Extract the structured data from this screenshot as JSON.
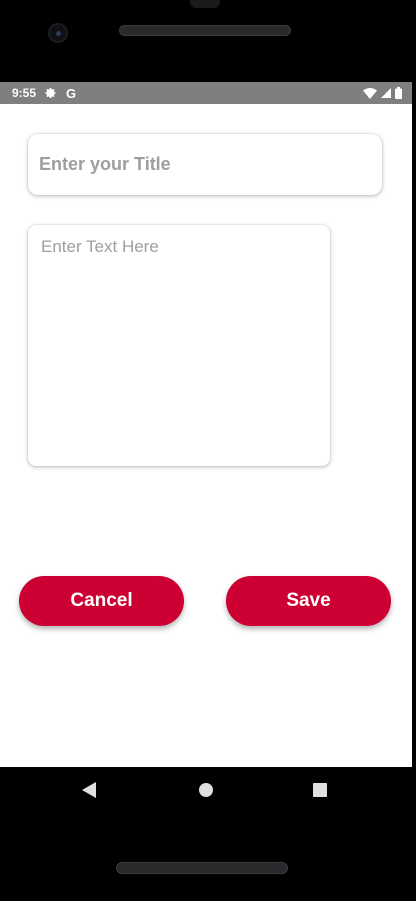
{
  "status_bar": {
    "time": "9:55",
    "google_letter": "G",
    "background": "#7f7f7f"
  },
  "note_form": {
    "title_placeholder": "Enter your Title",
    "title_value": "",
    "body_placeholder": "Enter Text Here",
    "body_value": ""
  },
  "actions": {
    "cancel_label": "Cancel",
    "save_label": "Save",
    "button_color": "#cc0033"
  },
  "icons": {
    "status": [
      "settings-icon",
      "google-icon",
      "wifi-icon",
      "signal-icon",
      "battery-icon"
    ],
    "navigation": [
      "back-icon",
      "home-icon",
      "recents-icon"
    ]
  }
}
